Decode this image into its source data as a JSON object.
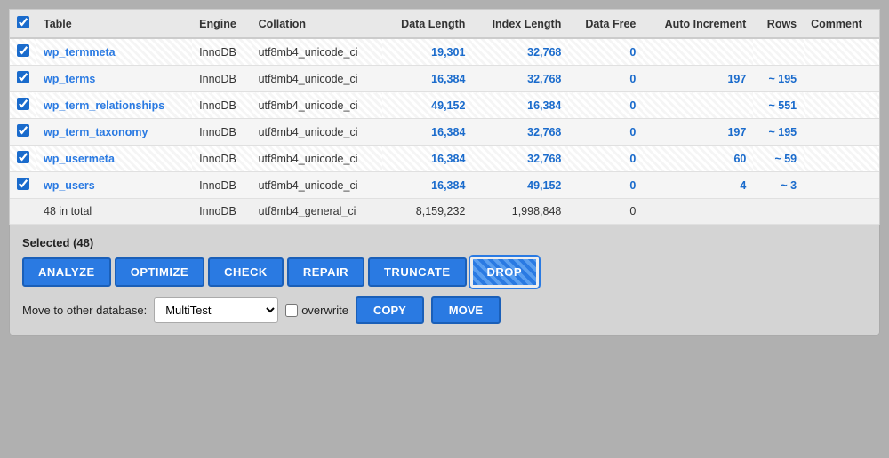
{
  "table": {
    "columns": [
      "",
      "Table",
      "Engine",
      "Collation",
      "Data Length",
      "Index Length",
      "Data Free",
      "Auto Increment",
      "Rows",
      "Comment"
    ],
    "rows": [
      {
        "checked": true,
        "name": "wp_termmeta",
        "engine": "InnoDB",
        "collation": "utf8mb4_unicode_ci",
        "dataLength": "19,301",
        "indexLength": "32,768",
        "dataFree": "0",
        "autoIncrement": "",
        "rows": "",
        "comment": "",
        "striped": true
      },
      {
        "checked": true,
        "name": "wp_terms",
        "engine": "InnoDB",
        "collation": "utf8mb4_unicode_ci",
        "dataLength": "16,384",
        "indexLength": "32,768",
        "dataFree": "0",
        "autoIncrement": "197",
        "rows": "~ 195",
        "comment": "",
        "striped": false
      },
      {
        "checked": true,
        "name": "wp_term_relationships",
        "engine": "InnoDB",
        "collation": "utf8mb4_unicode_ci",
        "dataLength": "49,152",
        "indexLength": "16,384",
        "dataFree": "0",
        "autoIncrement": "",
        "rows": "~ 551",
        "comment": "",
        "striped": true
      },
      {
        "checked": true,
        "name": "wp_term_taxonomy",
        "engine": "InnoDB",
        "collation": "utf8mb4_unicode_ci",
        "dataLength": "16,384",
        "indexLength": "32,768",
        "dataFree": "0",
        "autoIncrement": "197",
        "rows": "~ 195",
        "comment": "",
        "striped": false
      },
      {
        "checked": true,
        "name": "wp_usermeta",
        "engine": "InnoDB",
        "collation": "utf8mb4_unicode_ci",
        "dataLength": "16,384",
        "indexLength": "32,768",
        "dataFree": "0",
        "autoIncrement": "60",
        "rows": "~ 59",
        "comment": "",
        "striped": true
      },
      {
        "checked": true,
        "name": "wp_users",
        "engine": "InnoDB",
        "collation": "utf8mb4_unicode_ci",
        "dataLength": "16,384",
        "indexLength": "49,152",
        "dataFree": "0",
        "autoIncrement": "4",
        "rows": "~ 3",
        "comment": "",
        "striped": false
      }
    ],
    "total": {
      "label": "48 in total",
      "engine": "InnoDB",
      "collation": "utf8mb4_general_ci",
      "dataLength": "8,159,232",
      "indexLength": "1,998,848",
      "dataFree": "0"
    }
  },
  "bottomPanel": {
    "selectedLabel": "Selected (48)",
    "buttons": [
      {
        "label": "ANALYZE",
        "key": "analyze"
      },
      {
        "label": "OPTIMIZE",
        "key": "optimize"
      },
      {
        "label": "CHECK",
        "key": "check"
      },
      {
        "label": "REPAIR",
        "key": "repair"
      },
      {
        "label": "TRUNCATE",
        "key": "truncate"
      },
      {
        "label": "DROP",
        "key": "drop"
      }
    ],
    "moveToLabel": "Move to other database:",
    "dbSelectValue": "MultiTest",
    "dbOptions": [
      "MultiTest"
    ],
    "overwriteLabel": "overwrite",
    "copyLabel": "COPY",
    "moveLabel": "MOVE"
  }
}
